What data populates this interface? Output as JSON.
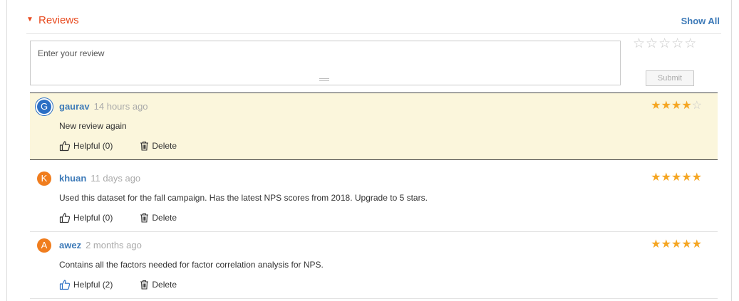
{
  "header": {
    "toggle_icon": "triangle-down-icon",
    "title": "Reviews",
    "show_all": "Show All"
  },
  "composer": {
    "placeholder": "Enter your review",
    "rating": 0,
    "max_rating": 5,
    "submit_label": "Submit"
  },
  "colors": {
    "accent": "#e8491d",
    "link": "#3d7ab8",
    "star": "#f5a623",
    "highlight": "#fbf6dc"
  },
  "reviews": [
    {
      "initial": "G",
      "author": "gaurav",
      "time": "14 hours ago",
      "text": "New review again",
      "helpful": "Helpful (0)",
      "delete": "Delete",
      "rating": 4
    },
    {
      "initial": "K",
      "author": "khuan",
      "time": "11 days ago",
      "text": "Used this dataset for the fall campaign. Has the latest NPS scores from 2018. Upgrade to 5 stars.",
      "helpful": "Helpful (0)",
      "delete": "Delete",
      "rating": 5
    },
    {
      "initial": "A",
      "author": "awez",
      "time": "2 months ago",
      "text": "Contains all the factors needed for factor correlation analysis for NPS.",
      "helpful": "Helpful (2)",
      "delete": "Delete",
      "rating": 5
    }
  ]
}
